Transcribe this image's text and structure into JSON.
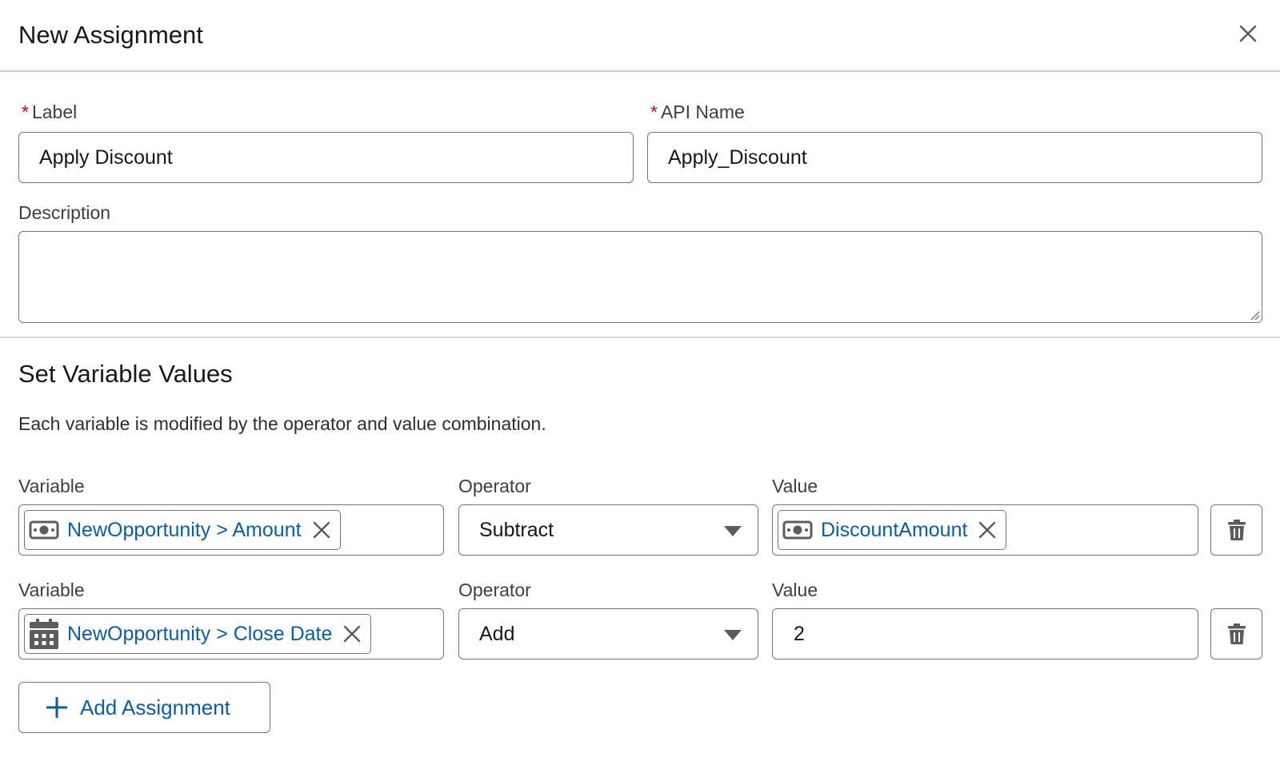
{
  "dialog": {
    "title": "New Assignment",
    "close_icon": "close-icon"
  },
  "fields": {
    "required_marker": "*",
    "label": {
      "label": "Label",
      "value": "Apply Discount",
      "required": true
    },
    "api_name": {
      "label": "API Name",
      "value": "Apply_Discount",
      "required": true
    },
    "description": {
      "label": "Description",
      "value": ""
    }
  },
  "section": {
    "title": "Set Variable Values",
    "help_text": "Each variable is modified by the operator and value combination."
  },
  "assignments": [
    {
      "variable_label": "Variable",
      "variable_value": "NewOpportunity > Amount",
      "variable_icon": "currency-icon",
      "operator_label": "Operator",
      "operator_value": "Subtract",
      "value_label": "Value",
      "value_value": "DiscountAmount",
      "value_icon": "currency-icon",
      "delete_icon": "trash-icon"
    },
    {
      "variable_label": "Variable",
      "variable_value": "NewOpportunity > Close Date",
      "variable_icon": "calendar-icon",
      "operator_label": "Operator",
      "operator_value": "Add",
      "value_label": "Value",
      "value_value": "2",
      "delete_icon": "trash-icon"
    }
  ],
  "add_assignment": {
    "label": "Add Assignment",
    "icon": "plus-icon"
  },
  "colors": {
    "link_blue": "#0b5cab",
    "required_red": "#ba0517",
    "border": "#747474"
  }
}
